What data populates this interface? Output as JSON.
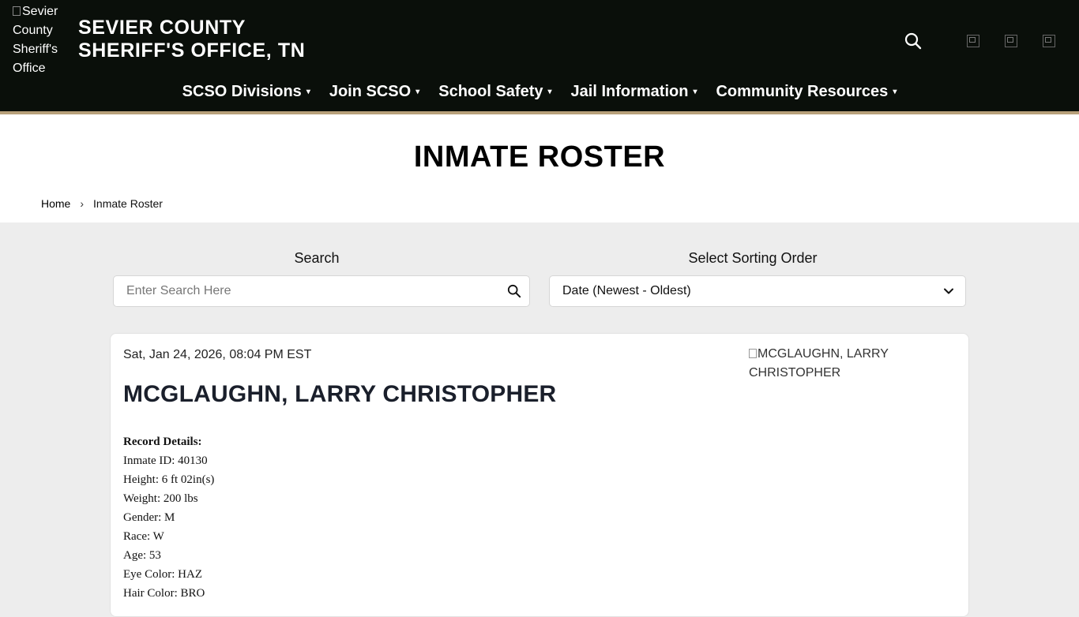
{
  "header": {
    "logo_alt": "Sevier County Sheriff's Office",
    "title_line1": "SEVIER COUNTY",
    "title_line2": "SHERIFF'S OFFICE, TN",
    "social_icons": [
      "facebook-icon",
      "twitter-icon",
      "instagram-icon"
    ]
  },
  "nav": {
    "items": [
      {
        "label": "SCSO Divisions"
      },
      {
        "label": "Join SCSO"
      },
      {
        "label": "School Safety"
      },
      {
        "label": "Jail Information"
      },
      {
        "label": "Community Resources"
      }
    ],
    "caret": "▾"
  },
  "page": {
    "title": "INMATE ROSTER",
    "breadcrumb": {
      "home": "Home",
      "separator": "›",
      "current": "Inmate Roster"
    }
  },
  "search": {
    "label": "Search",
    "placeholder": "Enter Search Here"
  },
  "sort": {
    "label": "Select Sorting Order",
    "selected": "Date (Newest - Oldest)"
  },
  "record": {
    "date": "Sat, Jan 24, 2026, 08:04 PM EST",
    "name": "MCGLAUGHN, LARRY CHRISTOPHER",
    "photo_alt": "MCGLAUGHN, LARRY CHRISTOPHER",
    "details_heading": "Record Details:",
    "details": [
      "Inmate ID: 40130",
      "Height: 6 ft 02in(s)",
      "Weight: 200 lbs",
      "Gender: M",
      "Race: W",
      "Age: 53",
      "Eye Color: HAZ",
      "Hair Color: BRO"
    ]
  },
  "colors": {
    "header_bg": "#0a0f0a",
    "header_border": "#b7a07a",
    "page_bg": "#ededed",
    "name_color": "#1a1f2b"
  }
}
